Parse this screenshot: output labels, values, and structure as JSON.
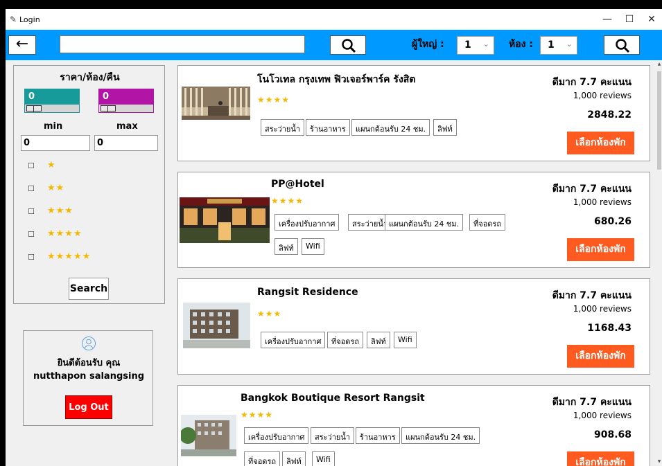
{
  "window": {
    "title": "Login",
    "minimize": "—",
    "maximize": "☐",
    "close": "✕"
  },
  "topbar": {
    "back_label": "←",
    "search_value": "",
    "adults_label": "ผู้ใหญ่ :",
    "adults_value": "1",
    "rooms_label": "ห้อง :",
    "rooms_value": "1",
    "caret": "⌄"
  },
  "filter": {
    "title": "ราคา/ห้อง/คืน",
    "min_display": "0",
    "max_display": "0",
    "min_label": "min",
    "max_label": "max",
    "min_entry": "0",
    "max_entry": "0",
    "star_options": [
      "★",
      "★★",
      "★★★",
      "★★★★",
      "★★★★★"
    ],
    "checkbox_glyph": "☐",
    "search_label": "Search"
  },
  "user": {
    "welcome": "ยินดีต้อนรับ คุณ",
    "name": "nutthapon  salangsing",
    "logout_label": "Log Out"
  },
  "hotels": [
    {
      "name": "โนโวเทล กรุงเทพ ฟิวเจอร์พาร์ค รังสิต",
      "stars": "★★★★",
      "amenities": [
        "สระว่ายน้ำ",
        "ร้านอาหาร",
        "แผนกต้อนรับ 24 ชม.",
        "ลิฟท์"
      ],
      "rating": "ดีมาก 7.7 คะแนน",
      "reviews": "1,000 reviews",
      "price": "2848.22",
      "select_label": "เลือกห้องพัก"
    },
    {
      "name": "PP@Hotel",
      "stars": "★★★★",
      "amenities": [
        "เครื่องปรับอากาศ",
        "สระว่ายน้ำ",
        "แผนกต้อนรับ 24 ชม.",
        "ที่จอดรถ",
        "ลิฟท์",
        "Wifi"
      ],
      "rating": "ดีมาก 7.7 คะแนน",
      "reviews": "1,000 reviews",
      "price": "680.26",
      "select_label": "เลือกห้องพัก"
    },
    {
      "name": "Rangsit Residence",
      "stars": "★★★",
      "amenities": [
        "เครื่องปรับอากาศ",
        "ที่จอดรถ",
        "ลิฟท์",
        "Wifi"
      ],
      "rating": "ดีมาก 7.7 คะแนน",
      "reviews": "1,000 reviews",
      "price": "1168.43",
      "select_label": "เลือกห้องพัก"
    },
    {
      "name": "Bangkok Boutique Resort Rangsit",
      "stars": "★★★★",
      "amenities": [
        "เครื่องปรับอากาศ",
        "สระว่ายน้ำ",
        "ร้านอาหาร",
        "แผนกต้อนรับ 24 ชม.",
        "ที่จอดรถ",
        "ลิฟท์",
        "Wifi"
      ],
      "rating": "ดีมาก 7.7 คะแนน",
      "reviews": "1,000 reviews",
      "price": "908.68",
      "select_label": "เลือกห้องพัก"
    }
  ]
}
